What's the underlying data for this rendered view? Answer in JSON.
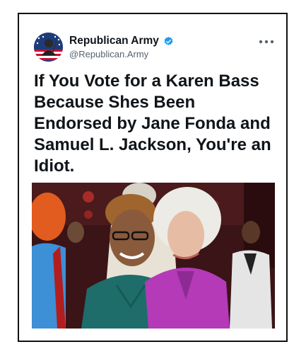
{
  "tweet": {
    "display_name": "Republican Army",
    "handle": "@Republican.Army",
    "verified_icon": "verified-badge-icon",
    "more_icon": "more-options-icon",
    "headline": "If You Vote for a Karen Bass Because Shes Been Endorsed by Jane Fonda and Samuel L. Jackson, You're an Idiot.",
    "colors": {
      "verified": "#1d9bf0",
      "text": "#0f1419",
      "handle": "#536471"
    }
  }
}
